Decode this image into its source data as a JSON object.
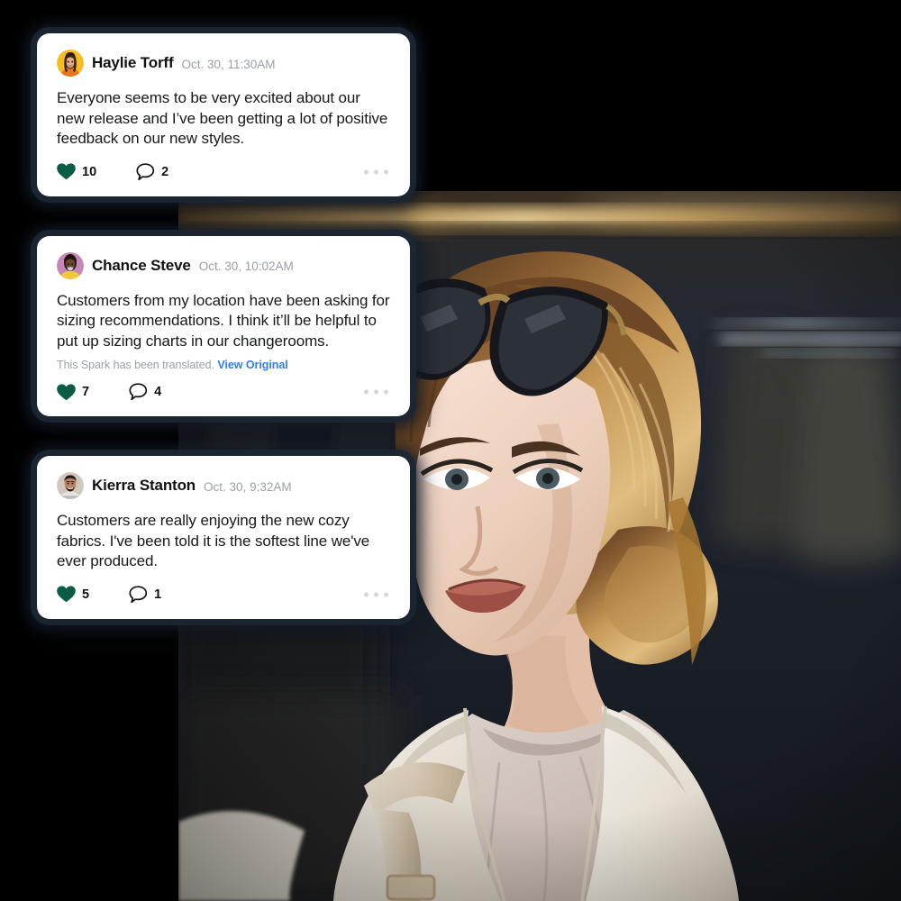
{
  "theme": {
    "background": "#000000",
    "card_background": "#ffffff",
    "card_glow": "#1c2633",
    "heart_color": "#0a5c46",
    "link_color": "#2f7ef0",
    "muted_text": "#9aa0a6",
    "body_text": "#16181a"
  },
  "photo": {
    "alt": "Woman with sunglasses on her head browsing clothing in a boutique store",
    "name": "store-shopper-photo"
  },
  "icons": {
    "heart": "heart-icon",
    "comment": "comment-icon",
    "more": "more-options-icon"
  },
  "cards": [
    {
      "author": "Haylie Torff",
      "timestamp": "Oct. 30, 11:30AM",
      "message": "Everyone seems to be very excited about our new release and I’ve been getting a lot of positive feedback on our new styles.",
      "likes": "10",
      "comments": "2",
      "translated": false,
      "translated_note": "",
      "translated_link": "",
      "avatar": "avatar-haylie-torff"
    },
    {
      "author": "Chance Steve",
      "timestamp": "Oct. 30, 10:02AM",
      "message": "Customers from my location have been asking for sizing recommendations. I think it’ll be helpful to put up sizing charts in our changerooms.",
      "likes": "7",
      "comments": "4",
      "translated": true,
      "translated_note": "This Spark has been translated.",
      "translated_link": "View Original",
      "avatar": "avatar-chance-steve"
    },
    {
      "author": "Kierra Stanton",
      "timestamp": "Oct. 30, 9:32AM",
      "message": "Customers are really enjoying the new cozy fabrics. I've been told it is the softest line we've ever produced.",
      "likes": "5",
      "comments": "1",
      "translated": false,
      "translated_note": "",
      "translated_link": "",
      "avatar": "avatar-kierra-stanton"
    }
  ]
}
